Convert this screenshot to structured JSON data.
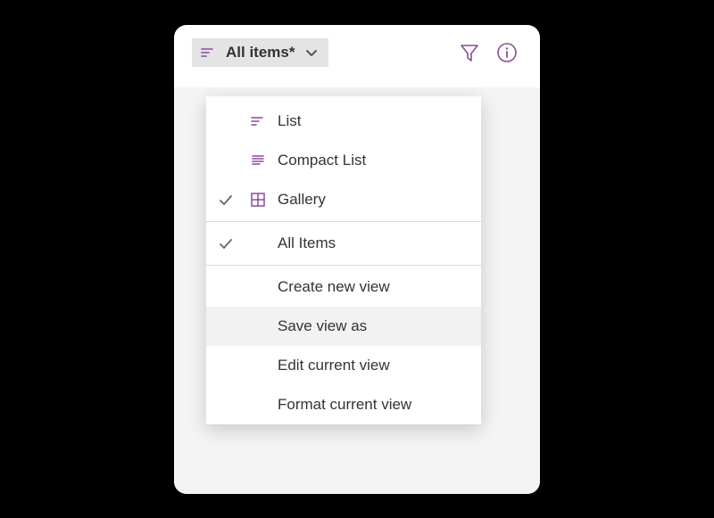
{
  "colors": {
    "accent": "#8c4a9e"
  },
  "toolbar": {
    "view_label": "All items*"
  },
  "menu": {
    "layouts": [
      {
        "key": "list",
        "label": "List",
        "selected": false
      },
      {
        "key": "compact",
        "label": "Compact List",
        "selected": false
      },
      {
        "key": "gallery",
        "label": "Gallery",
        "selected": true
      }
    ],
    "views": [
      {
        "key": "allitems",
        "label": "All Items",
        "selected": true
      }
    ],
    "actions": [
      {
        "key": "create",
        "label": "Create new view",
        "hover": false
      },
      {
        "key": "saveas",
        "label": "Save view as",
        "hover": true
      },
      {
        "key": "edit",
        "label": "Edit current view",
        "hover": false
      },
      {
        "key": "format",
        "label": "Format current view",
        "hover": false
      }
    ]
  }
}
